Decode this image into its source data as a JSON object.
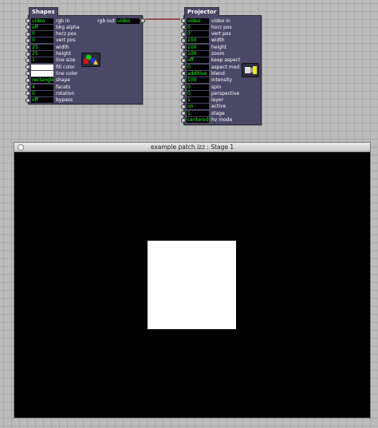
{
  "shapes_actor": {
    "title": "Shapes",
    "inputs": [
      {
        "value": "video",
        "name": "rgb in"
      },
      {
        "value": "off",
        "name": "bkg alpha"
      },
      {
        "value": "0",
        "name": "horz pos"
      },
      {
        "value": "0",
        "name": "vert pos"
      },
      {
        "value": "25",
        "name": "width"
      },
      {
        "value": "25",
        "name": "height"
      },
      {
        "value": "1",
        "name": "line size"
      },
      {
        "value": "",
        "name": "fill color"
      },
      {
        "value": "",
        "name": "line color"
      },
      {
        "value": "rectangle",
        "name": "shape"
      },
      {
        "value": "4",
        "name": "facets"
      },
      {
        "value": "0",
        "name": "rotation"
      },
      {
        "value": "off",
        "name": "bypass"
      }
    ],
    "output": {
      "name": "rgb out",
      "value": "video"
    }
  },
  "projector_actor": {
    "title": "Projector",
    "inputs": [
      {
        "value": "video",
        "name": "video in"
      },
      {
        "value": "0",
        "name": "horz pos"
      },
      {
        "value": "0",
        "name": "vert pos"
      },
      {
        "value": "100",
        "name": "width"
      },
      {
        "value": "100",
        "name": "height"
      },
      {
        "value": "100",
        "name": "zoom"
      },
      {
        "value": "off",
        "name": "keep aspect"
      },
      {
        "value": "0",
        "name": "aspect mod"
      },
      {
        "value": "additive",
        "name": "blend"
      },
      {
        "value": "100",
        "name": "intensity"
      },
      {
        "value": "0",
        "name": "spin"
      },
      {
        "value": "0",
        "name": "perspective"
      },
      {
        "value": "1",
        "name": "layer"
      },
      {
        "value": "on",
        "name": "active"
      },
      {
        "value": "1",
        "name": "stage"
      },
      {
        "value": "centered",
        "name": "hv mode"
      }
    ]
  },
  "stage_window": {
    "title": "example patch.izz : Stage 1"
  },
  "colors": {
    "actor_bg": "#4a4865",
    "value_text": "#23ff23",
    "connection": "#8b1a1a"
  }
}
